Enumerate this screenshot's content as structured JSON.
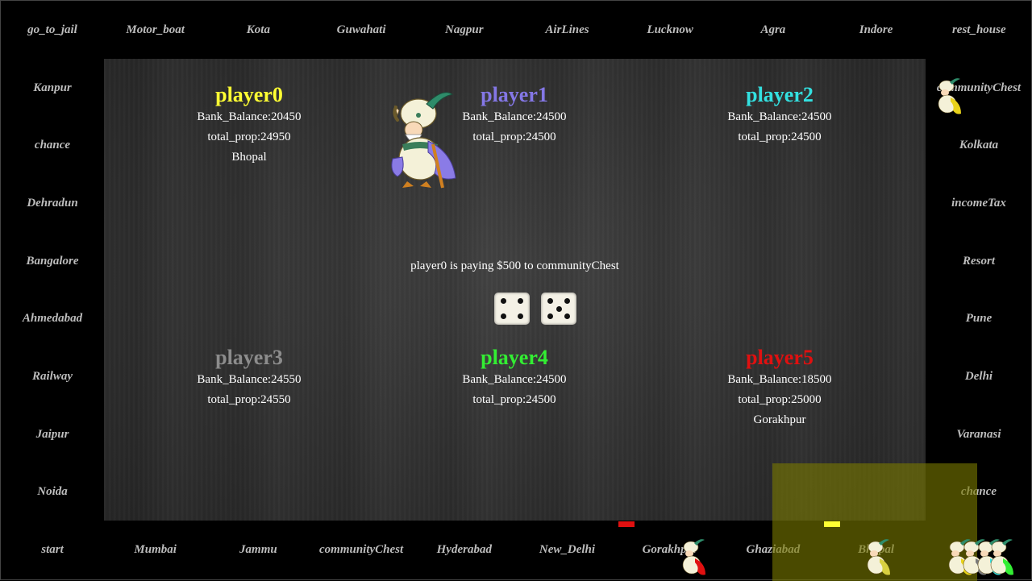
{
  "board": {
    "top_row": [
      "go_to_jail",
      "Motor_boat",
      "Kota",
      "Guwahati",
      "Nagpur",
      "AirLines",
      "Lucknow",
      "Agra",
      "Indore",
      "rest_house"
    ],
    "left_col": [
      "Kanpur",
      "chance",
      "Dehradun",
      "Bangalore",
      "Ahmedabad",
      "Railway",
      "Jaipur",
      "Noida"
    ],
    "right_col": [
      "communityChest",
      "Kolkata",
      "incomeTax",
      "Resort",
      "Pune",
      "Delhi",
      "Varanasi",
      "chance"
    ],
    "bottom_row": [
      "start",
      "Mumbai",
      "Jammu",
      "communityChest",
      "Hyderabad",
      "New_Delhi",
      "Gorakhpur",
      "Ghaziabad",
      "Bhopal",
      ""
    ]
  },
  "players": [
    {
      "name": "player0",
      "balance": "Bank_Balance:20450",
      "total": "total_prop:24950",
      "props": [
        "Bhopal"
      ],
      "color": "#ffff33"
    },
    {
      "name": "player1",
      "balance": "Bank_Balance:24500",
      "total": "total_prop:24500",
      "props": [],
      "color": "#8477e6"
    },
    {
      "name": "player2",
      "balance": "Bank_Balance:24500",
      "total": "total_prop:24500",
      "props": [],
      "color": "#33e0e0"
    },
    {
      "name": "player3",
      "balance": "Bank_Balance:24550",
      "total": "total_prop:24550",
      "props": [],
      "color": "#8c8c8c"
    },
    {
      "name": "player4",
      "balance": "Bank_Balance:24500",
      "total": "total_prop:24500",
      "props": [],
      "color": "#33ee33"
    },
    {
      "name": "player5",
      "balance": "Bank_Balance:18500",
      "total": "total_prop:25000",
      "props": [
        "Gorakhpur"
      ],
      "color": "#e01010"
    }
  ],
  "message": "player0 is paying $500 to communityChest",
  "dice": [
    4,
    5
  ],
  "colors": {
    "background": "#000000",
    "cell_text": "#bdbdbd",
    "overlay": "#787800",
    "marker_red": "#e01010",
    "marker_yellow": "#ffff33"
  },
  "icons": [
    "genie-token-icon",
    "die-icon"
  ]
}
